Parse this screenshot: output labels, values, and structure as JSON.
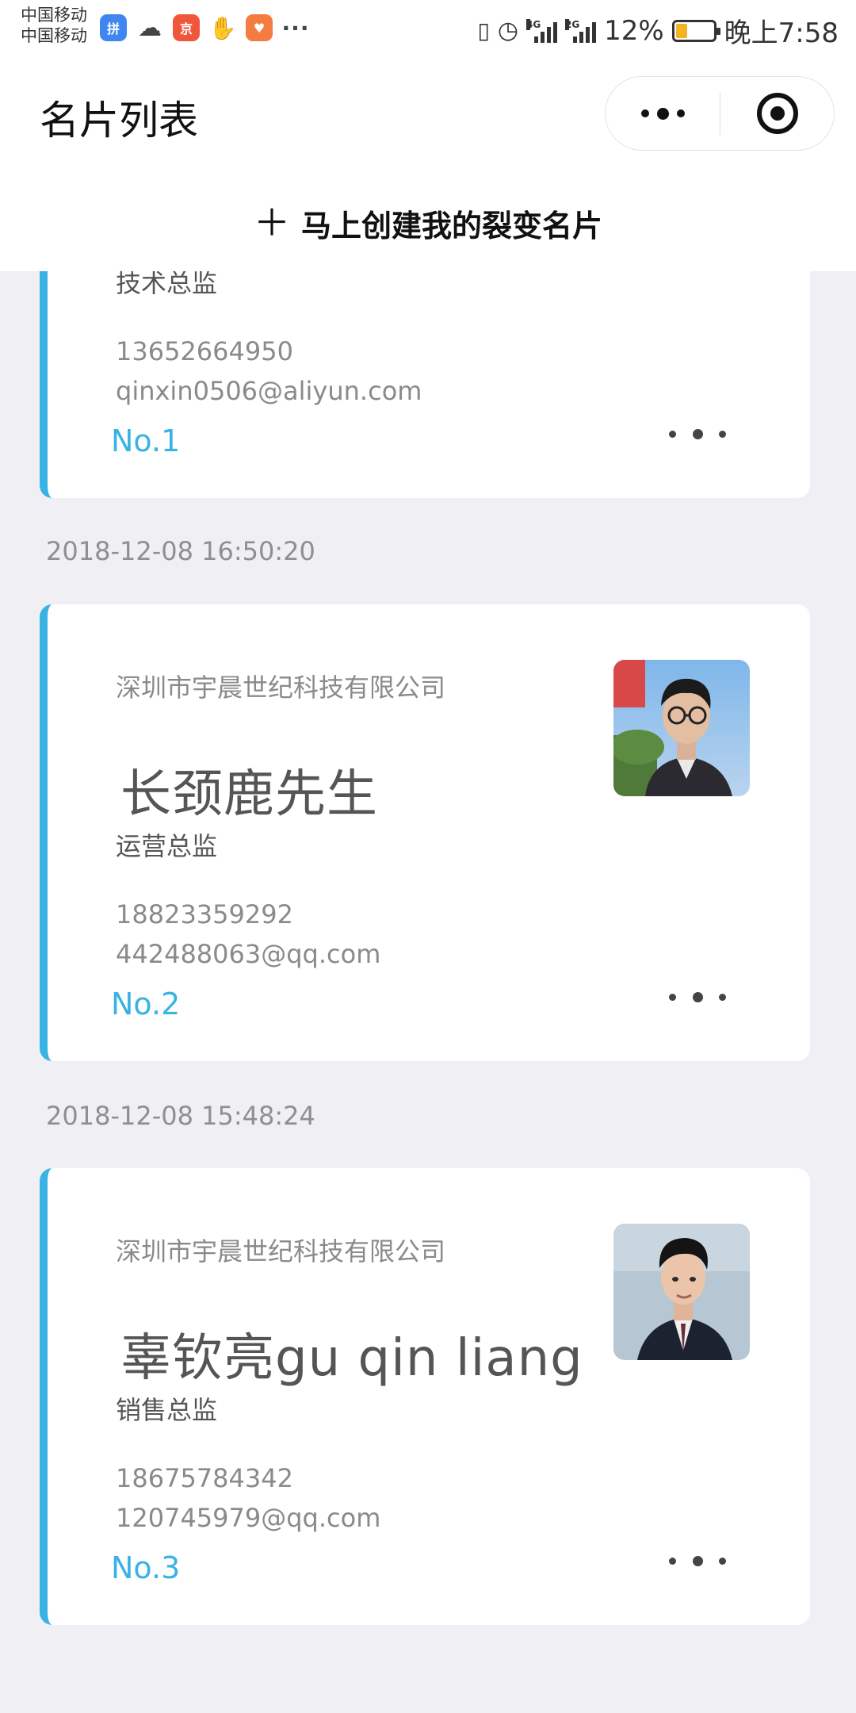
{
  "status_bar": {
    "carrier_1": "中国移动",
    "carrier_2": "中国移动",
    "signal_1_label": "4G",
    "signal_2_label": "2G",
    "battery_percent": "12%",
    "battery_level": 0.12,
    "battery_color": "#f4b323",
    "time": "晚上7:58",
    "notification_icons": [
      "pinduoduo-icon",
      "wechat-icon",
      "jd-icon",
      "hand-icon",
      "app-icon",
      "more-icon"
    ]
  },
  "nav": {
    "title": "名片列表",
    "menu_icon": "more-dots-icon",
    "close_icon": "target-icon"
  },
  "create": {
    "icon": "plus-icon",
    "label": "马上创建我的裂变名片"
  },
  "accent_color": "#38b3e3",
  "cards": [
    {
      "company": "",
      "name": "",
      "position": "技术总监",
      "phone": "13652664950",
      "email": "qinxin0506@aliyun.com",
      "number": "No.1",
      "timestamp": "2018-12-08 16:50:20"
    },
    {
      "company": "深圳市宇晨世纪科技有限公司",
      "name": "长颈鹿先生",
      "position": "运营总监",
      "phone": "18823359292",
      "email": "442488063@qq.com",
      "number": "No.2",
      "timestamp": "2018-12-08 15:48:24"
    },
    {
      "company": "深圳市宇晨世纪科技有限公司",
      "name": "辜钦亮gu qin liang",
      "position": "销售总监",
      "phone": "18675784342",
      "email": "120745979@qq.com",
      "number": "No.3"
    }
  ]
}
